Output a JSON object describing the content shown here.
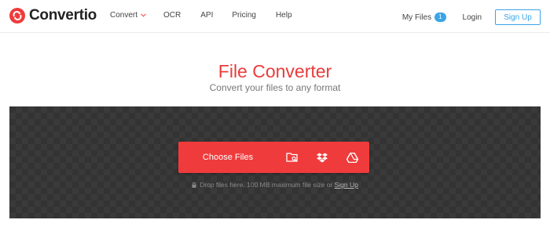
{
  "brand": {
    "name": "Convertio",
    "logo_color": "#ef3b3b"
  },
  "nav": {
    "items": [
      {
        "label": "Convert",
        "has_dropdown": true
      },
      {
        "label": "OCR"
      },
      {
        "label": "API"
      },
      {
        "label": "Pricing"
      },
      {
        "label": "Help"
      }
    ]
  },
  "account": {
    "my_files_label": "My Files",
    "my_files_count": "1",
    "login_label": "Login",
    "signup_label": "Sign Up"
  },
  "hero": {
    "title": "File Converter",
    "subtitle": "Convert your files to any format"
  },
  "uploader": {
    "choose_label": "Choose Files",
    "sources": [
      "folder-search-icon",
      "dropbox-icon",
      "google-drive-icon"
    ],
    "hint_text": "Drop files here. 100 MB maximum file size or",
    "hint_link": "Sign Up"
  },
  "colors": {
    "accent": "#ef3b3b",
    "link": "#3aa4e6",
    "drop_bg": "#333333"
  }
}
